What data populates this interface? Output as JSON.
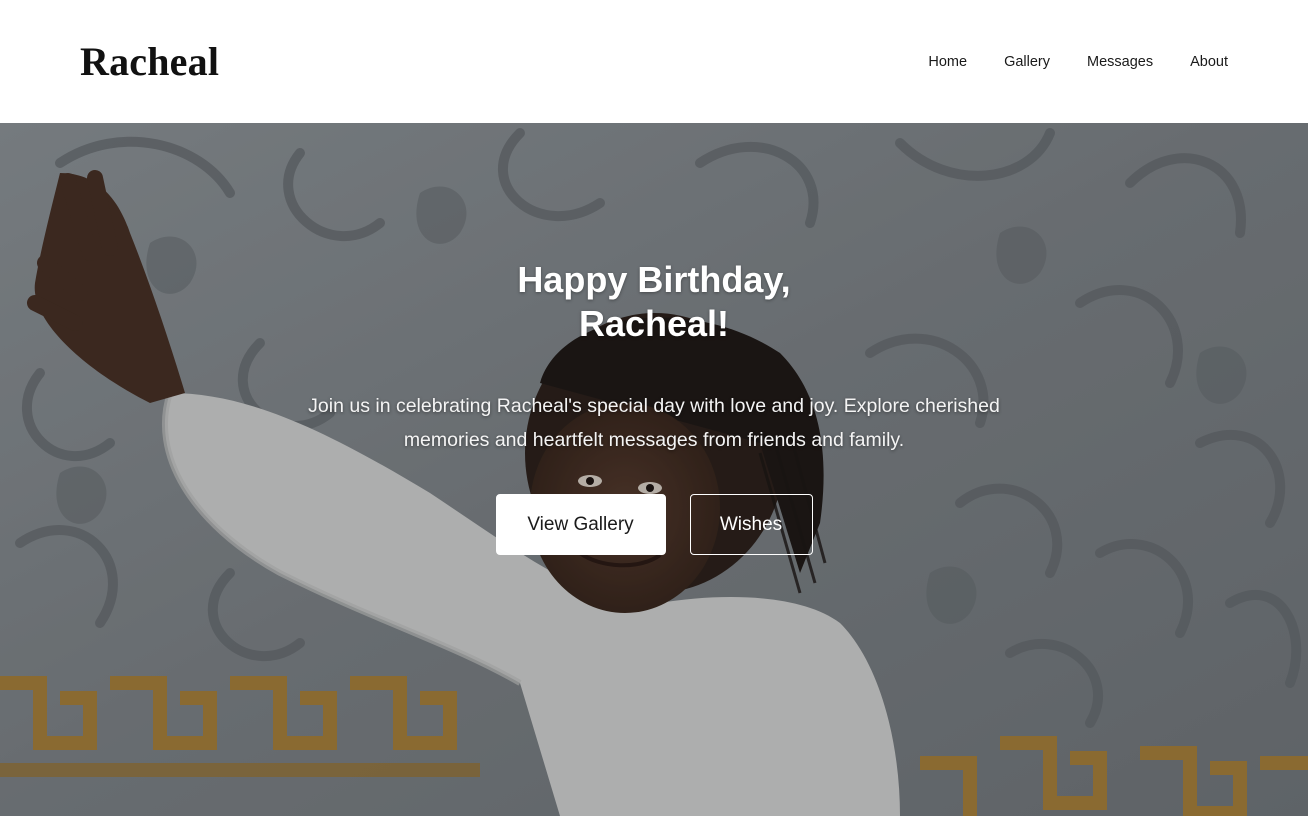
{
  "header": {
    "brand": "Racheal",
    "nav": [
      {
        "label": "Home"
      },
      {
        "label": "Gallery"
      },
      {
        "label": "Messages"
      },
      {
        "label": "About"
      }
    ]
  },
  "hero": {
    "title": "Happy Birthday, Racheal!",
    "subtitle": "Join us in celebrating Racheal's special day with love and joy. Explore cherished memories and heartfelt messages from friends and family.",
    "primary_button": "View Gallery",
    "secondary_button": "Wishes"
  },
  "colors": {
    "header_bg": "#ffffff",
    "brand_text": "#111111",
    "hero_text": "#ffffff",
    "wall": "#8a8f93",
    "gold_trim": "#b8893a"
  }
}
